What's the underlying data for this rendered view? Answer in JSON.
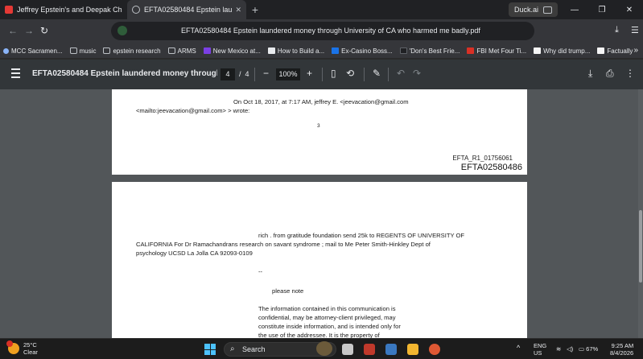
{
  "browser": {
    "tabs": [
      {
        "title": "Jeffrey Epstein's and Deepak Chop",
        "favicon_color": "#e53935",
        "active": false
      },
      {
        "title": "EFTA02580484 Epstein launde",
        "favicon_color": "#9aa0a6",
        "active": true
      }
    ],
    "new_tab_label": "+",
    "duck_label": "Duck.ai",
    "omnibox_text": "EFTA02580484 Epstein laundered money through University of CA who harmed me badly.pdf",
    "bookmarks": [
      {
        "label": "MCC Sacramen...",
        "icon": "sparkle-icon",
        "color": "#8ab4f8"
      },
      {
        "label": "music",
        "icon": "folder-icon",
        "color": "#bdc1c6"
      },
      {
        "label": "epstein research",
        "icon": "folder-icon",
        "color": "#bdc1c6"
      },
      {
        "label": "ARMS",
        "icon": "folder-icon",
        "color": "#bdc1c6"
      },
      {
        "label": "New Mexico at...",
        "icon": "site-icon",
        "color": "#7b3fe4"
      },
      {
        "label": "How to Build a...",
        "icon": "site-icon",
        "color": "#e8eaed"
      },
      {
        "label": "Ex-Casino Boss...",
        "icon": "site-icon",
        "color": "#1a73e8"
      },
      {
        "label": "'Don's Best Frie...",
        "icon": "site-icon",
        "color": "#202124"
      },
      {
        "label": "FBI Met Four Ti...",
        "icon": "site-icon",
        "color": "#d93025"
      },
      {
        "label": "Why did trump...",
        "icon": "site-icon",
        "color": "#f5f5f5"
      },
      {
        "label": "Factually",
        "icon": "site-icon",
        "color": "#f5f5f5"
      }
    ]
  },
  "pdf_toolbar": {
    "title": "EFTA02580484 Epstein laundered money through Uni...",
    "current_page": "4",
    "page_separator": "/",
    "total_pages": "4",
    "zoom_minus": "−",
    "zoom_level": "100%",
    "zoom_plus": "+"
  },
  "document": {
    "page1": {
      "line1": "On Oct 18, 2017, at 7:17 AM, jeffrey E. <jeevacation@gmail.com",
      "line2": "<mailto:jeevacation@gmail.com> > wrote:",
      "page_number": "3",
      "bates_small": "EFTA_R1_01756061",
      "bates_large": "EFTA02580486"
    },
    "page2": {
      "line1": "rich .  from gratitude foundation  send  25k to REGENTS OF UNIVERSITY OF",
      "line2": "CALIFORNIA    For Dr Ramachandrans research on savant syndrome   ; mail to   Me Peter Smith-Hinkley Dept of",
      "line3": "psychology  UCSD  La Jolla CA 92093-0109",
      "dashes": "--",
      "please_note": "please note",
      "notice1": "The information contained in this communication is",
      "notice2": "confidential, may be attorney-client privileged, may",
      "notice3": "constitute inside information, and is intended only for",
      "notice4": "the use of the addressee. It is the property of"
    }
  },
  "taskbar": {
    "temperature": "25°C",
    "condition": "Clear",
    "search_label": "Search",
    "language_top": "ENG",
    "language_bottom": "US",
    "battery": "67%",
    "time": "9:25 AM",
    "date": "8/4/2026"
  }
}
